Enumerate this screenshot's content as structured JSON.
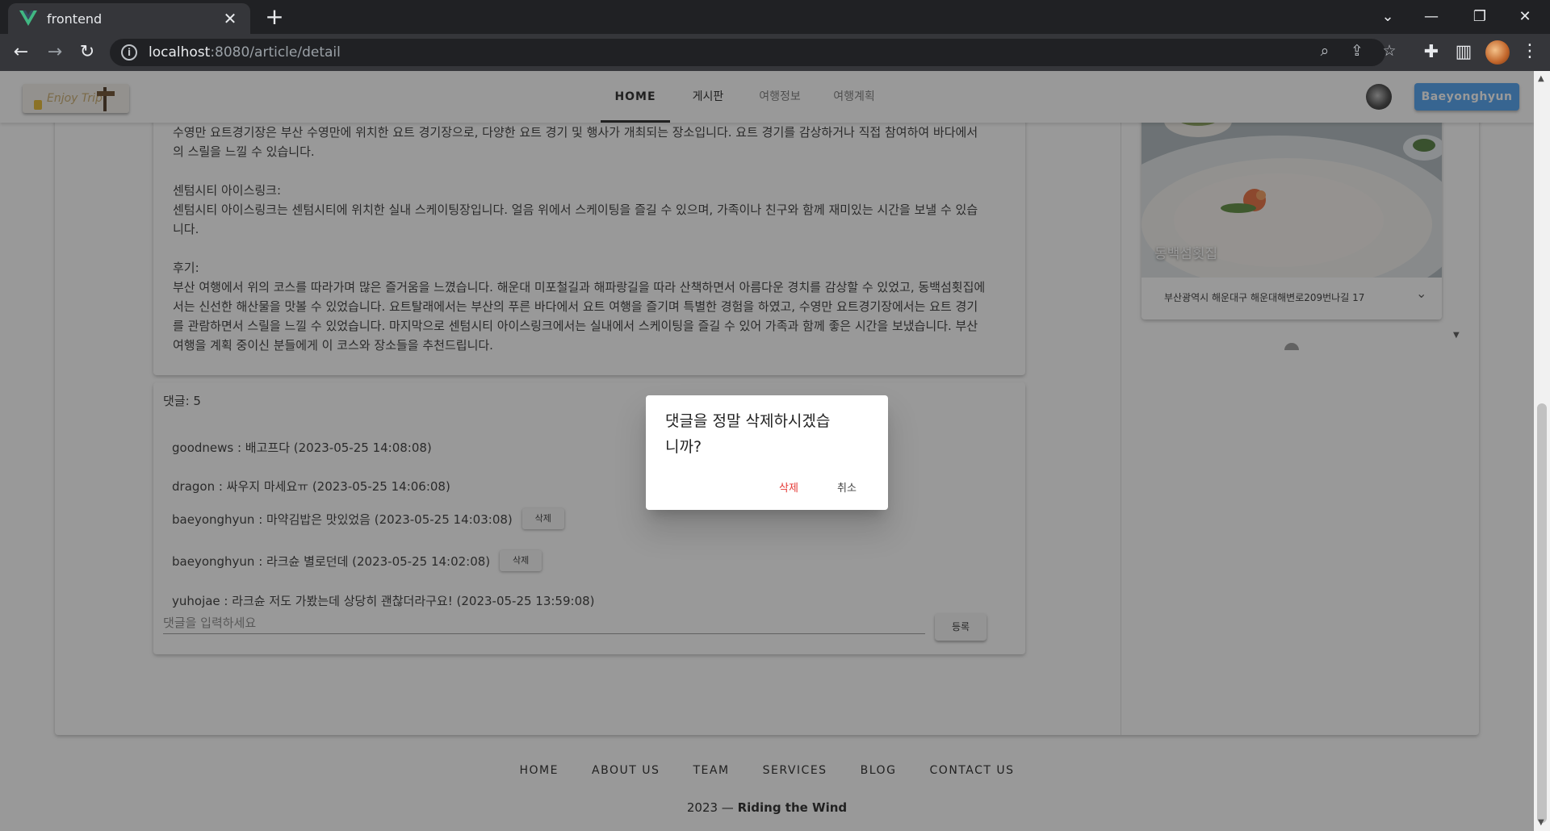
{
  "browser": {
    "tab_title": "frontend",
    "url_host": "localhost",
    "url_path": ":8080/article/detail"
  },
  "header": {
    "logo_text": "Enjoy Trip",
    "nav": [
      "HOME",
      "게시판",
      "여행정보",
      "여행계획"
    ],
    "user_button": "Baeyonghyun"
  },
  "article": {
    "paragraphs": [
      "수영만 요트경기장은 부산 수영만에 위치한 요트 경기장으로, 다양한 요트 경기 및 행사가 개최되는 장소입니다. 요트 경기를 감상하거나 직접 참여하여 바다에서의 스릴을 느낄 수 있습니다.",
      "",
      "센텀시티 아이스링크:",
      "센텀시티 아이스링크는 센텀시티에 위치한 실내 스케이팅장입니다. 얼음 위에서 스케이팅을 즐길 수 있으며, 가족이나 친구와 함께 재미있는 시간을 보낼 수 있습니다.",
      "",
      "후기:",
      "부산 여행에서 위의 코스를 따라가며 많은 즐거움을 느꼈습니다. 해운대 미포철길과 해파랑길을 따라 산책하면서 아름다운 경치를 감상할 수 있었고, 동백섬횟집에서는 신선한 해산물을 맛볼 수 있었습니다. 요트탈래에서는 부산의 푸른 바다에서 요트 여행을 즐기며 특별한 경험을 하였고, 수영만 요트경기장에서는 요트 경기를 관람하면서 스릴을 느낄 수 있었습니다. 마지막으로 센텀시티 아이스링크에서는 실내에서 스케이팅을 즐길 수 있어 가족과 함께 좋은 시간을 보냈습니다. 부산 여행을 계획 중이신 분들에게 이 코스와 장소들을 추천드립니다."
    ]
  },
  "comments": {
    "count_label": "댓글: 5",
    "items": [
      {
        "text": "goodnews : 배고프다 (2023-05-25 14:08:08)"
      },
      {
        "text": "dragon : 싸우지 마세요ㅠ (2023-05-25 14:06:08)"
      },
      {
        "text": "baeyonghyun : 마약김밥은 맛있었음 (2023-05-25 14:03:08)",
        "delete_label": "삭제"
      },
      {
        "text": "baeyonghyun : 라크슌 별로던데 (2023-05-25 14:02:08)",
        "delete_label": "삭제"
      },
      {
        "text": "yuhojae : 라크슌 저도 가봤는데 상당히 괜찮더라구요! (2023-05-25 13:59:08)"
      }
    ],
    "input_placeholder": "댓글을 입력하세요",
    "submit_label": "등록"
  },
  "place": {
    "name": "동백섬횟집",
    "address": "부산광역시 해운대구 해운대해변로209번나길 17"
  },
  "footer": {
    "links": [
      "HOME",
      "ABOUT US",
      "TEAM",
      "SERVICES",
      "BLOG",
      "CONTACT US"
    ],
    "copyright_prefix": "2023 — ",
    "copyright_brand": "Riding the Wind"
  },
  "dialog": {
    "title": "댓글을 정말 삭제하시겠습니까?",
    "confirm_label": "삭제",
    "cancel_label": "취소"
  },
  "colors": {
    "primary_button": "#4a9ff0",
    "danger": "#e53935",
    "chrome_dark": "#202124"
  }
}
